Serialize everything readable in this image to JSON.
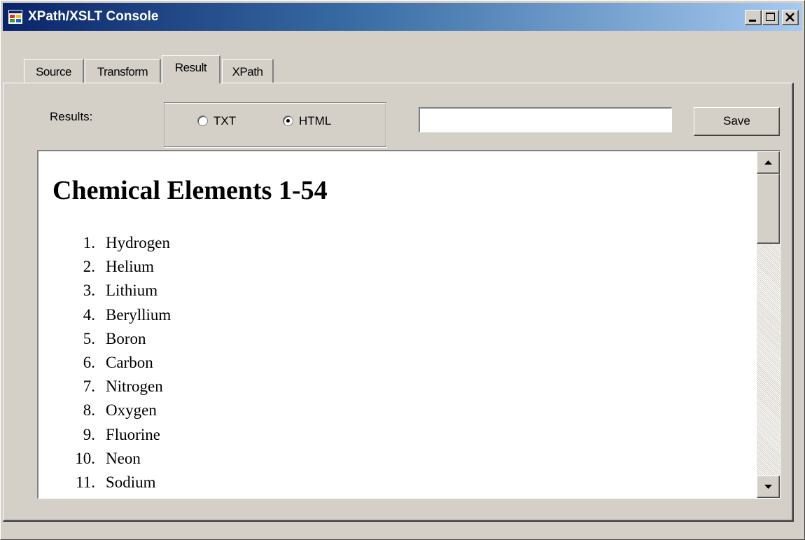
{
  "window": {
    "title": "XPath/XSLT Console",
    "minimize_icon": "minimize-icon",
    "maximize_icon": "maximize-icon",
    "close_icon": "close-icon"
  },
  "tabs": [
    {
      "label": "Source",
      "selected": false
    },
    {
      "label": "Transform",
      "selected": false
    },
    {
      "label": "Result",
      "selected": true
    },
    {
      "label": "XPath",
      "selected": false
    }
  ],
  "result_panel": {
    "results_label": "Results:",
    "format_options": [
      {
        "label": "TXT",
        "checked": false
      },
      {
        "label": "HTML",
        "checked": true
      }
    ],
    "path_input_value": "",
    "save_label": "Save"
  },
  "document": {
    "heading": "Chemical Elements 1-54",
    "items": [
      {
        "num": "1.",
        "name": "Hydrogen"
      },
      {
        "num": "2.",
        "name": "Helium"
      },
      {
        "num": "3.",
        "name": "Lithium"
      },
      {
        "num": "4.",
        "name": "Beryllium"
      },
      {
        "num": "5.",
        "name": "Boron"
      },
      {
        "num": "6.",
        "name": "Carbon"
      },
      {
        "num": "7.",
        "name": "Nitrogen"
      },
      {
        "num": "8.",
        "name": "Oxygen"
      },
      {
        "num": "9.",
        "name": "Fluorine"
      },
      {
        "num": "10.",
        "name": "Neon"
      },
      {
        "num": "11.",
        "name": "Sodium"
      }
    ]
  },
  "colors": {
    "titlebar_start": "#0a246a",
    "titlebar_end": "#a6caf0",
    "face": "#d4d0c8"
  }
}
